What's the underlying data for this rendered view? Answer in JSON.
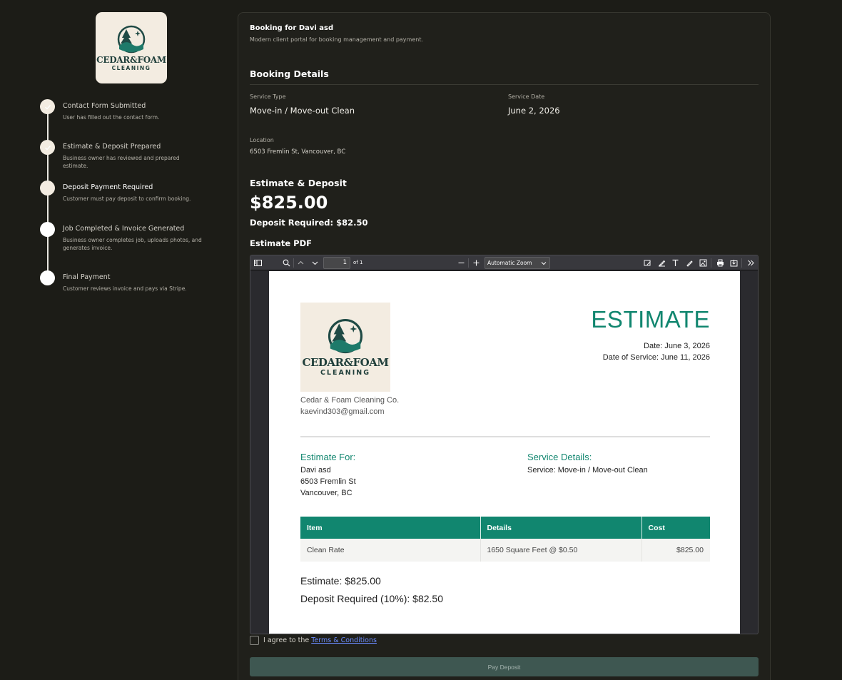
{
  "brand": {
    "name_line1": "CEDAR&FOAM",
    "name_line2": "CLEANING"
  },
  "timeline": [
    {
      "title": "Contact Form Submitted",
      "desc": "User has filled out the contact form."
    },
    {
      "title": "Estimate & Deposit Prepared",
      "desc": "Business owner has reviewed and prepared estimate."
    },
    {
      "title": "Deposit Payment Required",
      "desc": "Customer must pay deposit to confirm booking."
    },
    {
      "title": "Job Completed & Invoice Generated",
      "desc": "Business owner completes job, uploads photos, and generates invoice."
    },
    {
      "title": "Final Payment",
      "desc": "Customer reviews invoice and pays via Stripe."
    }
  ],
  "header": {
    "title": "Booking for Davi asd",
    "subtitle": "Modern client portal for booking management and payment."
  },
  "booking": {
    "section_title": "Booking Details",
    "service_type_label": "Service Type",
    "service_type": "Move-in / Move-out Clean",
    "service_date_label": "Service Date",
    "service_date": "June 2, 2026",
    "location_label": "Location",
    "location": "6503 Fremlin St, Vancouver, BC"
  },
  "estimate": {
    "section_title": "Estimate & Deposit",
    "amount": "$825.00",
    "deposit": "Deposit Required: $82.50",
    "pdf_label": "Estimate PDF"
  },
  "viewer": {
    "page_number": "1",
    "page_of": "of 1",
    "zoom": "Automatic Zoom"
  },
  "pdf": {
    "title": "ESTIMATE",
    "date": "Date: June 3, 2026",
    "service_date": "Date of Service: June 11, 2026",
    "company": "Cedar & Foam Cleaning Co.",
    "email": "kaevind303@gmail.com",
    "estimate_for_heading": "Estimate For:",
    "client_name": "Davi asd",
    "client_street": "6503 Fremlin St",
    "client_city": "Vancouver, BC",
    "service_details_heading": "Service Details:",
    "service_line": "Service: Move-in / Move-out Clean",
    "table": {
      "headers": [
        "Item",
        "Details",
        "Cost"
      ],
      "rows": [
        [
          "Clean Rate",
          "1650 Square Feet @ $0.50",
          "$825.00"
        ]
      ]
    },
    "estimate_total": "Estimate: $825.00",
    "deposit_total": "Deposit Required (10%): $82.50"
  },
  "footer": {
    "agree_text": "I agree to the",
    "terms_link": "Terms & Conditions",
    "pay_button": "Pay Deposit"
  },
  "colors": {
    "accent": "#11866f",
    "background": "#1c1c17",
    "button": "#3e5751"
  }
}
